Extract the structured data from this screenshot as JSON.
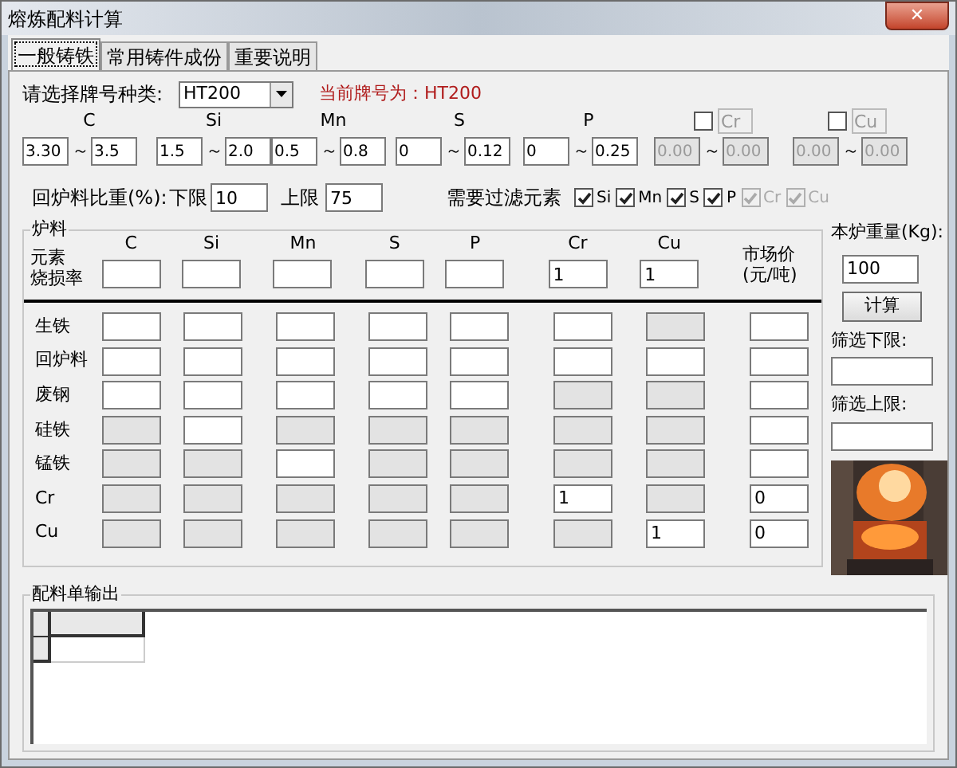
{
  "window": {
    "title": "熔炼配料计算",
    "close": "✕"
  },
  "tabs": [
    {
      "label": "一般铸铁",
      "selected": true
    },
    {
      "label": "常用铸件成份",
      "selected": false
    },
    {
      "label": "重要说明",
      "selected": false
    }
  ],
  "grade": {
    "label": "请选择牌号种类:",
    "value": "HT200",
    "current": "当前牌号为：HT200"
  },
  "ranges": [
    {
      "kind": "plain",
      "element": "C",
      "min": "3.30",
      "max": "3.5",
      "separator": "～",
      "disabled": false
    },
    {
      "kind": "plain",
      "element": "Si",
      "min": "1.5",
      "max": "2.0",
      "separator": "～",
      "disabled": false
    },
    {
      "kind": "plain",
      "element": "Mn",
      "min": "0.5",
      "max": "0.8",
      "separator": "～",
      "disabled": false
    },
    {
      "kind": "plain",
      "element": "S",
      "min": "0",
      "max": "0.12",
      "separator": "～",
      "disabled": false
    },
    {
      "kind": "plain",
      "element": "P",
      "min": "0",
      "max": "0.25",
      "separator": "～",
      "disabled": false
    },
    {
      "kind": "optional",
      "element": "Cr",
      "checked": false,
      "min": "0.00",
      "max": "0.00",
      "separator": "～",
      "disabled": true
    },
    {
      "kind": "optional",
      "element": "Cu",
      "checked": false,
      "min": "0.00",
      "max": "0.00",
      "separator": "～",
      "disabled": true
    }
  ],
  "return_ratio": {
    "label": "回炉料比重(%):",
    "lower_label": "下限",
    "lower": "10",
    "upper_label": "上限",
    "upper": "75"
  },
  "filter": {
    "label": "需要过滤元素",
    "items": [
      {
        "label": "Si",
        "checked": true,
        "disabled": false
      },
      {
        "label": "Mn",
        "checked": true,
        "disabled": false
      },
      {
        "label": "S",
        "checked": true,
        "disabled": false
      },
      {
        "label": "P",
        "checked": true,
        "disabled": false
      },
      {
        "label": "Cr",
        "checked": true,
        "disabled": true
      },
      {
        "label": "Cu",
        "checked": true,
        "disabled": true
      }
    ]
  },
  "materials": {
    "title": "炉料",
    "element_label": "元素",
    "burn_label": "烧损率",
    "columns": [
      "C",
      "Si",
      "Mn",
      "S",
      "P",
      "Cr",
      "Cu"
    ],
    "price_label": [
      "市场价",
      "(元/吨)"
    ],
    "burn_rates": [
      {
        "disabled": false
      },
      {
        "disabled": false
      },
      {
        "disabled": false
      },
      {
        "disabled": false
      },
      {
        "disabled": false
      },
      {
        "disabled": false,
        "value": "1"
      },
      {
        "disabled": false,
        "value": "1"
      }
    ],
    "rows": [
      {
        "name": "生铁",
        "cells": [
          {
            "disabled": false
          },
          {
            "disabled": false
          },
          {
            "disabled": false
          },
          {
            "disabled": false
          },
          {
            "disabled": false
          },
          {
            "disabled": false
          },
          {
            "disabled": true
          },
          {
            "disabled": false
          }
        ]
      },
      {
        "name": "回炉料",
        "cells": [
          {
            "disabled": false
          },
          {
            "disabled": false
          },
          {
            "disabled": false
          },
          {
            "disabled": false
          },
          {
            "disabled": false
          },
          {
            "disabled": false
          },
          {
            "disabled": false
          },
          {
            "disabled": false
          }
        ]
      },
      {
        "name": "废钢",
        "cells": [
          {
            "disabled": false
          },
          {
            "disabled": false
          },
          {
            "disabled": false
          },
          {
            "disabled": false
          },
          {
            "disabled": false
          },
          {
            "disabled": true
          },
          {
            "disabled": true
          },
          {
            "disabled": false
          }
        ]
      },
      {
        "name": "硅铁",
        "cells": [
          {
            "disabled": true
          },
          {
            "disabled": false
          },
          {
            "disabled": true
          },
          {
            "disabled": true
          },
          {
            "disabled": true
          },
          {
            "disabled": true
          },
          {
            "disabled": true
          },
          {
            "disabled": false
          }
        ]
      },
      {
        "name": "锰铁",
        "cells": [
          {
            "disabled": true
          },
          {
            "disabled": true
          },
          {
            "disabled": false
          },
          {
            "disabled": true
          },
          {
            "disabled": true
          },
          {
            "disabled": true
          },
          {
            "disabled": true
          },
          {
            "disabled": false
          }
        ]
      },
      {
        "name": "Cr",
        "cells": [
          {
            "disabled": true
          },
          {
            "disabled": true
          },
          {
            "disabled": true
          },
          {
            "disabled": true
          },
          {
            "disabled": true
          },
          {
            "disabled": false,
            "value": "1"
          },
          {
            "disabled": true
          },
          {
            "disabled": false,
            "value": "0"
          }
        ]
      },
      {
        "name": "Cu",
        "cells": [
          {
            "disabled": true
          },
          {
            "disabled": true
          },
          {
            "disabled": true
          },
          {
            "disabled": true
          },
          {
            "disabled": true
          },
          {
            "disabled": true
          },
          {
            "disabled": false,
            "value": "1"
          },
          {
            "disabled": false,
            "value": "0"
          }
        ]
      }
    ]
  },
  "side": {
    "weight_label": "本炉重量(Kg):",
    "weight": "100",
    "calc_button": "计算",
    "lower_label": "筛选下限:",
    "upper_label": "筛选上限:"
  },
  "output": {
    "title": "配料单输出"
  }
}
